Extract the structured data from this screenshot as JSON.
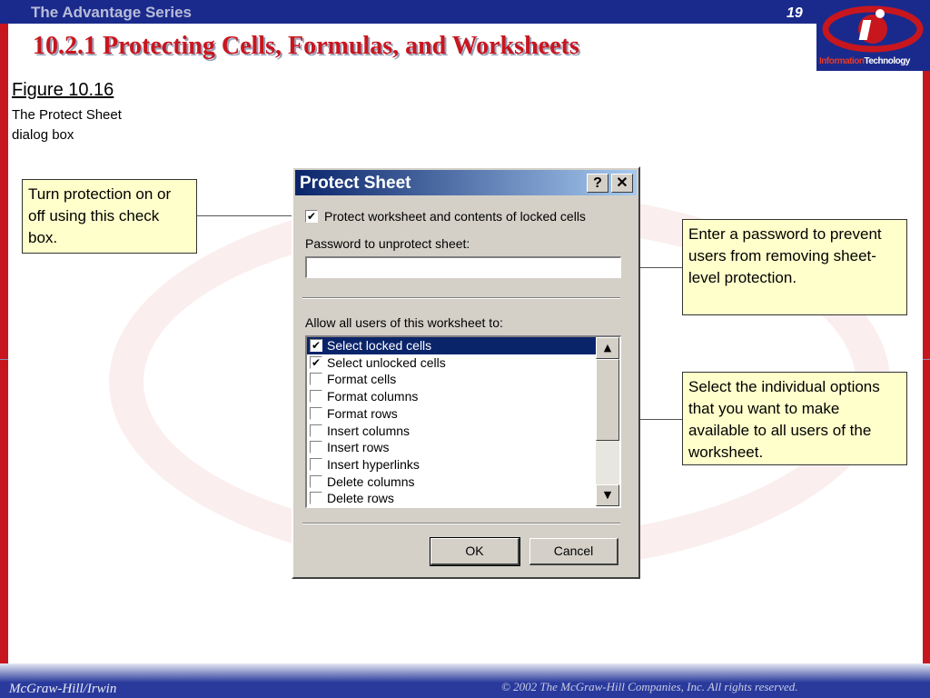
{
  "slide": {
    "series": "The Advantage Series",
    "page_number": "19",
    "title": "10.2.1 Protecting Cells, Formulas, and Worksheets",
    "logo_text_red": "Information",
    "logo_text_white": "Technology",
    "footer_left": "McGraw-Hill/Irwin",
    "footer_right": "© 2002  The McGraw-Hill Companies, Inc. All rights reserved."
  },
  "figure": {
    "title": "Figure 10.16",
    "caption": "The Protect Sheet dialog box"
  },
  "callouts": {
    "checkbox": "Turn protection on or off using this check box.",
    "password": "Enter a password to prevent users from removing sheet-level protection.",
    "options": "Select the individual options that you want to make available to all users of the worksheet."
  },
  "dialog": {
    "title": "Protect Sheet",
    "help_button": "?",
    "close_button": "✕",
    "protect_label": "Protect worksheet and contents of locked cells",
    "protect_checked": true,
    "password_label": "Password to unprotect sheet:",
    "password_value": "",
    "allow_label": "Allow all users of this worksheet to:",
    "options": [
      {
        "label": "Select locked cells",
        "checked": true,
        "selected": true
      },
      {
        "label": "Select unlocked cells",
        "checked": true,
        "selected": false
      },
      {
        "label": "Format cells",
        "checked": false,
        "selected": false
      },
      {
        "label": "Format columns",
        "checked": false,
        "selected": false
      },
      {
        "label": "Format rows",
        "checked": false,
        "selected": false
      },
      {
        "label": "Insert columns",
        "checked": false,
        "selected": false
      },
      {
        "label": "Insert rows",
        "checked": false,
        "selected": false
      },
      {
        "label": "Insert hyperlinks",
        "checked": false,
        "selected": false
      },
      {
        "label": "Delete columns",
        "checked": false,
        "selected": false
      },
      {
        "label": "Delete rows",
        "checked": false,
        "selected": false
      }
    ],
    "ok_label": "OK",
    "cancel_label": "Cancel"
  },
  "colors": {
    "brand_blue": "#1a2a8c",
    "brand_red": "#c8161e",
    "callout_fill": "#ffffcc",
    "selection": "#0a246a"
  },
  "icons": {
    "check": "✔",
    "scroll_up": "▲",
    "scroll_down": "▼"
  }
}
